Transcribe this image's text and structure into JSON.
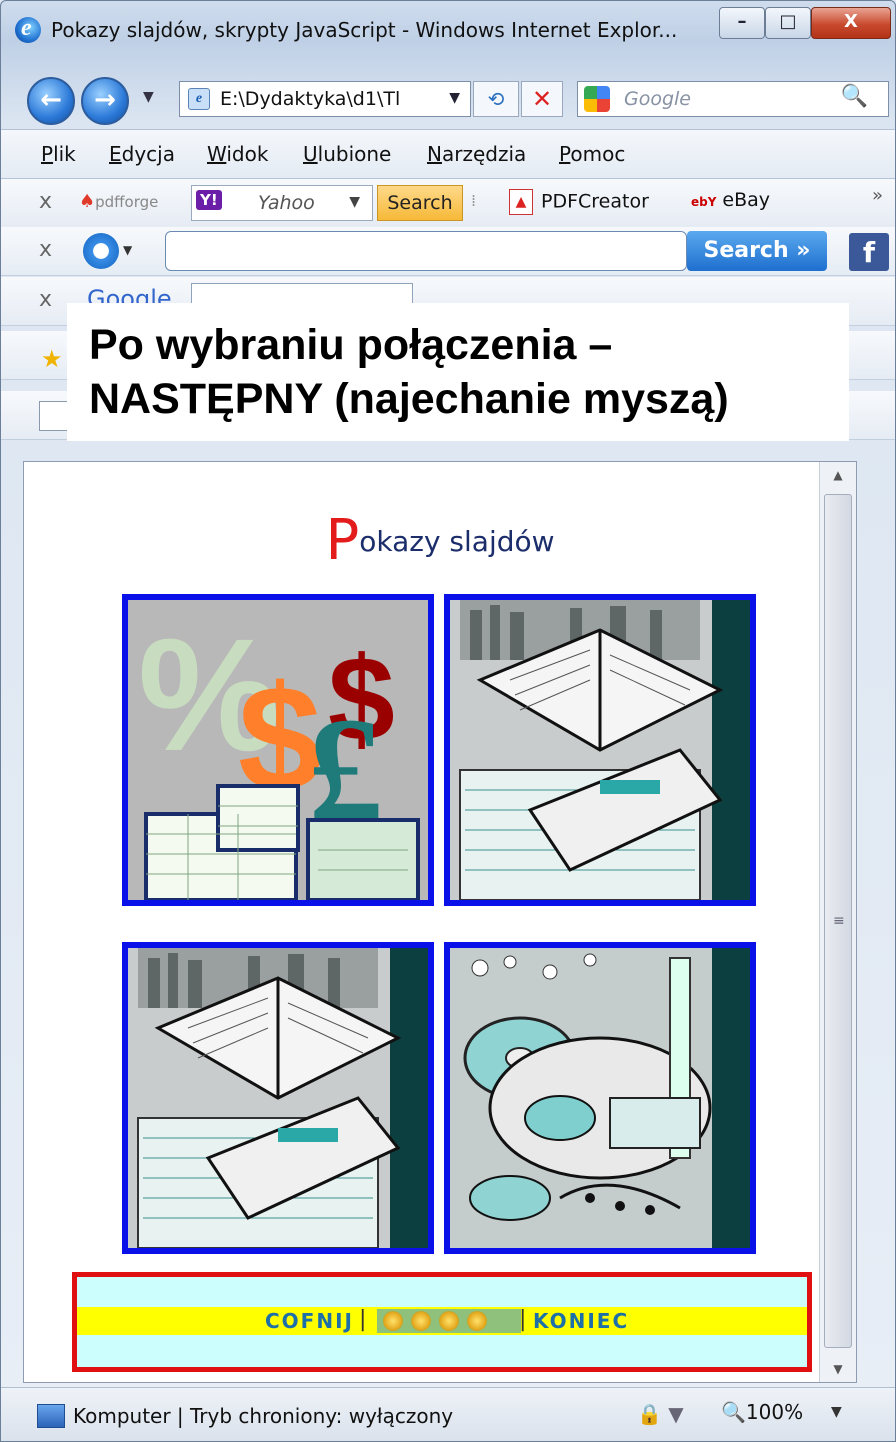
{
  "window": {
    "title": "Pokazy slajdów, skrypty JavaScript - Windows Internet Explor...",
    "min": "–",
    "max": "□",
    "close": "X"
  },
  "navbar": {
    "back": "←",
    "forward": "→",
    "dropdown": "▼",
    "address": "E:\\Dydaktyka\\d1\\Tl",
    "address_arrow": "▼",
    "refresh": "⟲",
    "stop": "✕",
    "search_placeholder": "Google",
    "search_icon": "🔍"
  },
  "menu": [
    "Plik",
    "Edycja",
    "Widok",
    "Ulubione",
    "Narzędzia",
    "Pomoc"
  ],
  "toolbar1": {
    "close": "x",
    "pdfforge": "pdfforge",
    "yahoo_logo": "Y!",
    "yahoo_text": "Yahoo",
    "dropdown": "▼",
    "search_button": "Search",
    "pdfcreator": "PDFCreator",
    "ebay": "eBay",
    "more": "»"
  },
  "toolbar2": {
    "close": "x",
    "search_button": "Search »",
    "facebook": "f"
  },
  "toolbar3": {
    "close": "x",
    "google": "Google"
  },
  "callout": {
    "line1": "Po wybraniu połączenia –",
    "line2": "NASTĘPNY (najechanie myszą)"
  },
  "page": {
    "heading_initial": "P",
    "heading_rest": "okazy slajdów",
    "nav_prev": "COFNIJ",
    "nav_sep": "|",
    "nav_end": "KONIEC"
  },
  "images": [
    "finance-currency-clipart",
    "books-clipart",
    "books-clipart",
    "music-cd-clipart"
  ],
  "statusbar": {
    "text": "Komputer | Tryb chroniony: wyłączony",
    "zoom": "100%",
    "zoom_arrow": "▼",
    "security_arrow": "▼"
  }
}
